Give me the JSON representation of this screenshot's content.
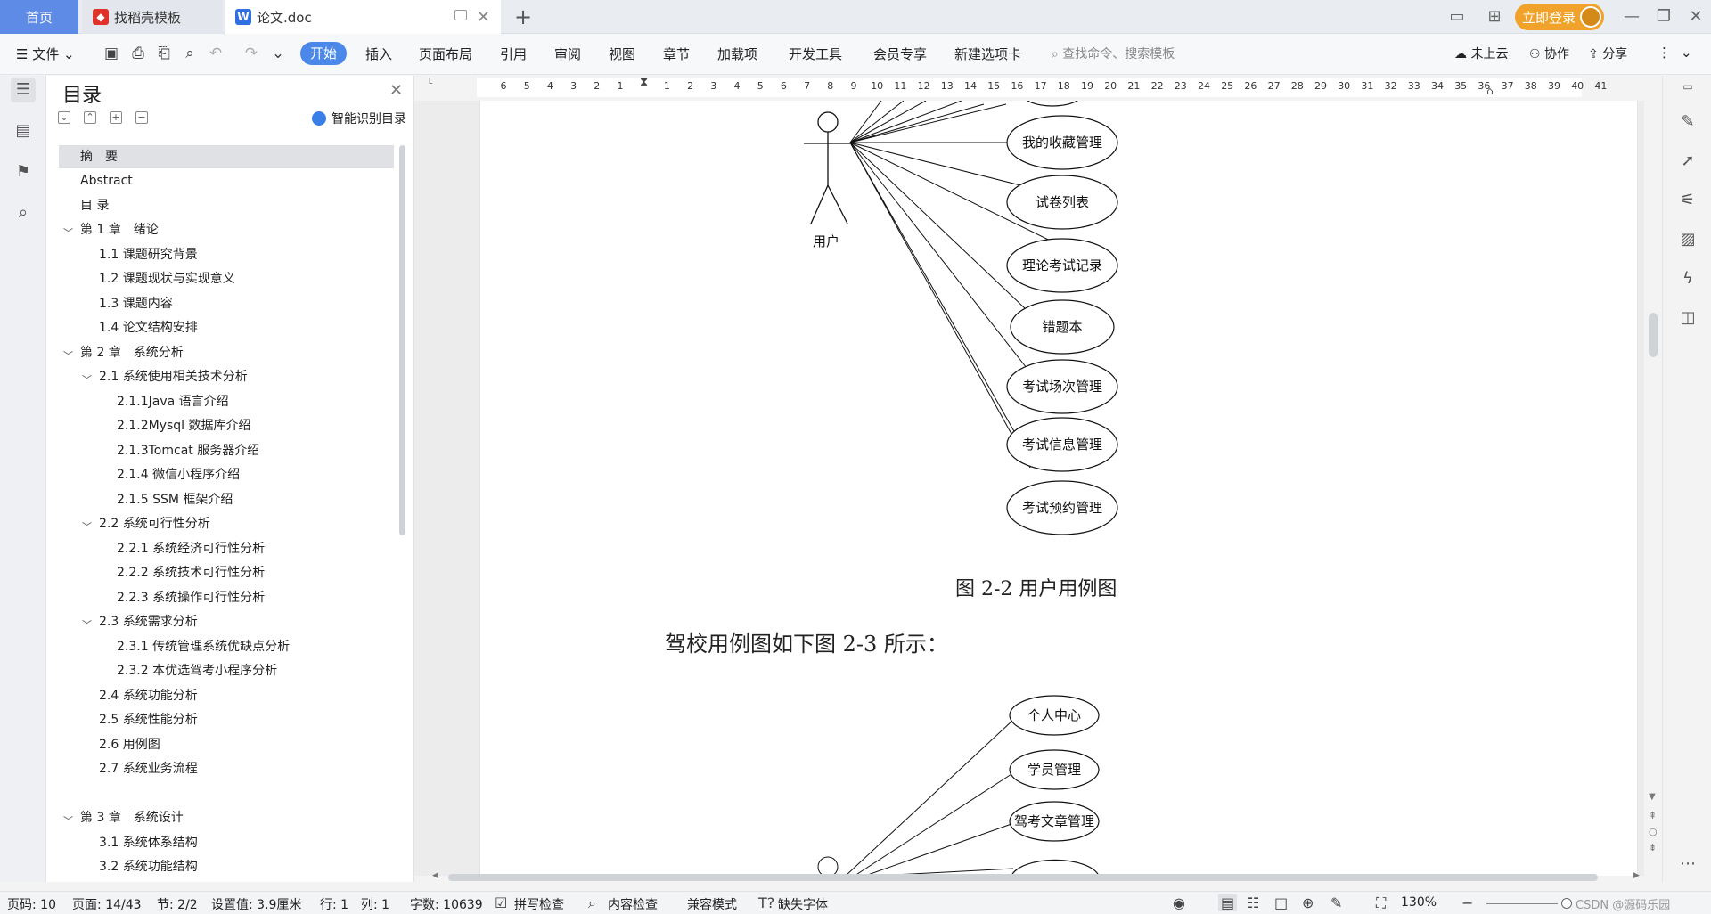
{
  "tabs": {
    "home": "首页",
    "template": "找稻壳模板",
    "document": "论文.doc"
  },
  "window": {
    "login": "立即登录"
  },
  "menu": {
    "file": "文件",
    "items": [
      "开始",
      "插入",
      "页面布局",
      "引用",
      "审阅",
      "视图",
      "章节",
      "加载项",
      "开发工具",
      "会员专享",
      "新建选项卡"
    ],
    "search_placeholder": "查找命令、搜索模板",
    "cloud": "未上云",
    "collab": "协作",
    "share": "分享"
  },
  "toc": {
    "title": "目录",
    "smart": "智能识别目录",
    "items": [
      "摘　要",
      "Abstract",
      "目 录",
      "第 1 章　绪论",
      "1.1 课题研究背景",
      "1.2 课题现状与实现意义",
      "1.3 课题内容",
      "1.4 论文结构安排",
      "第 2 章　系统分析",
      "2.1 系统使用相关技术分析",
      "2.1.1Java 语言介绍",
      "2.1.2Mysql 数据库介绍",
      "2.1.3Tomcat 服务器介绍",
      "2.1.4 微信小程序介绍",
      "2.1.5 SSM 框架介绍",
      "2.2 系统可行性分析",
      "2.2.1 系统经济可行性分析",
      "2.2.2 系统技术可行性分析",
      "2.2.3 系统操作可行性分析",
      "2.3 系统需求分析",
      "2.3.1 传统管理系统优缺点分析",
      "2.3.2 本优选驾考小程序分析",
      "2.4 系统功能分析",
      "2.5 系统性能分析",
      "2.6 用例图",
      "2.7 系统业务流程",
      "第 3 章　系统设计",
      "3.1 系统体系结构",
      "3.2 系统功能结构"
    ]
  },
  "ruler": {
    "ticks": [
      "6",
      "5",
      "4",
      "3",
      "2",
      "1",
      "",
      "1",
      "2",
      "3",
      "4",
      "5",
      "6",
      "7",
      "8",
      "9",
      "10",
      "11",
      "12",
      "13",
      "14",
      "15",
      "16",
      "17",
      "18",
      "19",
      "20",
      "21",
      "22",
      "23",
      "24",
      "25",
      "26",
      "27",
      "28",
      "29",
      "30",
      "31",
      "32",
      "33",
      "34",
      "35",
      "36",
      "37",
      "38",
      "39",
      "40",
      "41"
    ]
  },
  "document": {
    "diagram1": {
      "actor": "用户",
      "use_cases": [
        "我的收藏管理",
        "试卷列表",
        "理论考试记录",
        "错题本",
        "考试场次管理",
        "考试信息管理",
        "考试预约管理"
      ],
      "caption": "图 2-2 用户用例图"
    },
    "paragraph": "驾校用例图如下图 2-3 所示：",
    "diagram2": {
      "use_cases": [
        "个人中心",
        "学员管理",
        "驾考文章管理"
      ]
    }
  },
  "status": {
    "page_num": "页码: 10",
    "page": "页面: 14/43",
    "section": "节: 2/2",
    "setting": "设置值: 3.9厘米",
    "row": "行: 1",
    "col": "列: 1",
    "words": "字数: 10639",
    "spell": "拼写检查",
    "content": "内容检查",
    "compat": "兼容模式",
    "missing_font": "缺失字体",
    "zoom": "130%",
    "watermark": "CSDN @源码乐园"
  },
  "colors": {
    "accent": "#4c88ea",
    "home_tab": "#5d8be5",
    "login": "#f0a22a"
  }
}
